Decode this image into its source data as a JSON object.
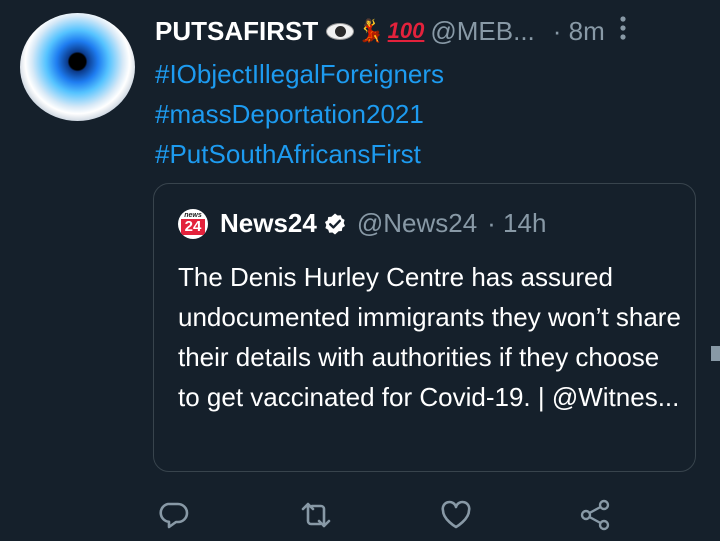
{
  "tweet": {
    "avatar_icon": "eye-avatar-icon",
    "display_name": "PUTSAFIRST",
    "name_emojis": [
      "eye-emoji",
      "dancer-emoji",
      "hundred-points-emoji"
    ],
    "hundred_label": "100",
    "handle": "@MEB...",
    "time": "· 8m",
    "more_icon": "more-vertical-icon",
    "hashtags": [
      "#IObjectIllegalForeigners",
      "#massDeportation2021",
      "#PutSouthAfricansFirst"
    ]
  },
  "quote": {
    "logo_small": "news",
    "logo_number": "24",
    "display_name": "News24",
    "verified_icon": "verified-badge-icon",
    "handle": "@News24",
    "time": "· 14h",
    "text": "The Denis Hurley Centre has assured undocumented immigrants they won’t share their details with authorities if they choose to get vaccinated for Covid-19. | @Witnes..."
  },
  "actions": [
    "reply-icon",
    "retweet-icon",
    "like-icon",
    "share-icon"
  ],
  "colors": {
    "background": "#15202b",
    "link": "#1d9bf0",
    "muted": "#8899a6",
    "border": "#38444d"
  }
}
